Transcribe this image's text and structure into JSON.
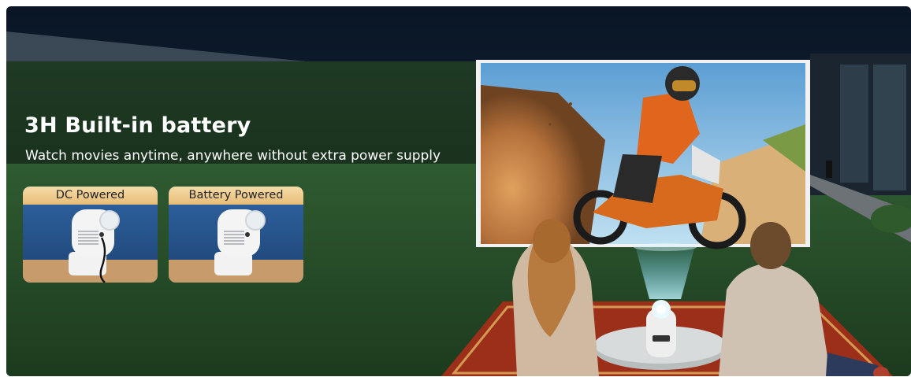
{
  "headline": "3H Built-in battery",
  "subheadline": "Watch movies anytime, anywhere without extra power supply",
  "power_modes": [
    {
      "label": "DC Powered"
    },
    {
      "label": "Battery Powered"
    }
  ],
  "colors": {
    "night_sky": "#0b1a2c",
    "lawn": "#2c5a2f",
    "label_gold": "#e7bc78",
    "card_blue": "#2a5b96",
    "beam": "#9fe6ff"
  },
  "illustration": {
    "scene": "night-backyard-projection",
    "screen_content": "dirt-bike-rider",
    "product": "portable-projector"
  }
}
